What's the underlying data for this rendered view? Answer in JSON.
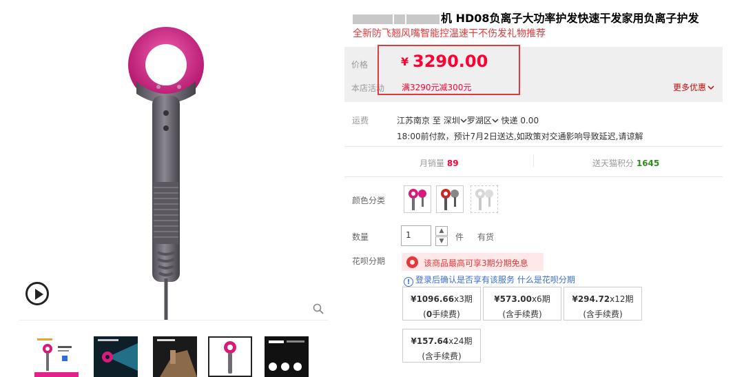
{
  "product": {
    "title_text": "机 HD08负离子大功率护发快速干发家用负离子护发",
    "subtitle": "全新防飞翘风嘴智能控温速干不伤发礼物推荐"
  },
  "price": {
    "label": "价格",
    "currency": "¥",
    "value": "3290.00",
    "promo_label": "本店活动",
    "promo_text": "满3290元减300元",
    "more_promos": "更多优惠"
  },
  "shipping": {
    "label": "运费",
    "from": "江苏南京",
    "to_word": "至",
    "city": "深圳",
    "district": "罗湖区",
    "method": "快递 0.00",
    "eta": "18:00前付款，预计7月2日送达,如政策对交通影响导致延迟,请谅解"
  },
  "stats": {
    "monthly_sales_label": "月销量",
    "monthly_sales": "89",
    "points_label": "送天猫积分",
    "points": "1645"
  },
  "color": {
    "label": "颜色分类"
  },
  "quantity": {
    "label": "数量",
    "value": "1",
    "unit": "件",
    "stock": "有货"
  },
  "huabei": {
    "label": "花呗分期",
    "banner": "该商品最高可享3期分期免息",
    "login_note": "登录后确认是否享有该服务",
    "what_is": "什么是花呗分期",
    "plans": [
      {
        "amount": "¥1096.66",
        "term": "x3期",
        "fee_prefix": "(",
        "fee_bold": "0",
        "fee_suffix": "手续费)"
      },
      {
        "amount": "¥573.00",
        "term": "x6期",
        "fee_prefix": "(含手续费)",
        "fee_bold": "",
        "fee_suffix": ""
      },
      {
        "amount": "¥294.72",
        "term": "x12期",
        "fee_prefix": "(含手续费)",
        "fee_bold": "",
        "fee_suffix": ""
      },
      {
        "amount": "¥157.64",
        "term": "x24期",
        "fee_prefix": "(含手续费)",
        "fee_bold": "",
        "fee_suffix": ""
      }
    ]
  },
  "colors": {
    "accent": "#ff0036",
    "highlight_border": "#e4393c",
    "link": "#3a6fd8",
    "price_bg": "#efefef",
    "dryer_pink": "#d81b7a",
    "dryer_gray": "#6e6b74"
  }
}
